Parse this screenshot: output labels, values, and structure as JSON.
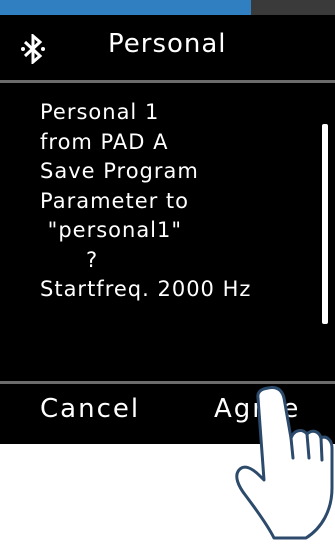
{
  "header": {
    "title": "Personal",
    "icon": "bluetooth-icon"
  },
  "progress": {
    "fraction": 0.75
  },
  "message": {
    "lines": [
      "Personal 1",
      "from PAD A",
      "Save Program",
      "Parameter to",
      " \"personal1\"",
      "      ?",
      "Startfreq. 2000 Hz"
    ]
  },
  "buttons": {
    "cancel": "Cancel",
    "agree": "Agree"
  },
  "colors": {
    "screen": "#000000",
    "progress_fill": "#2f7fc1",
    "progress_track": "#3a3a3a",
    "divider": "#6b6b6b",
    "text": "#ffffff"
  },
  "overlay": {
    "icon": "tapping-hand-icon"
  }
}
